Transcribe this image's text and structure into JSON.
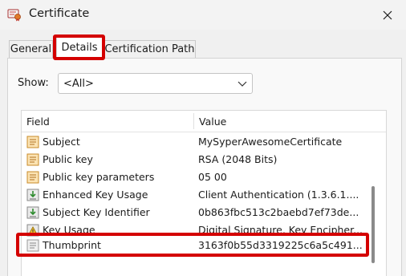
{
  "window": {
    "title": "Certificate"
  },
  "tabs": [
    {
      "label": "General"
    },
    {
      "label": "Details"
    },
    {
      "label": "Certification Path"
    }
  ],
  "show": {
    "label": "Show:",
    "selected": "<All>"
  },
  "table": {
    "headers": {
      "field": "Field",
      "value": "Value"
    },
    "rows": [
      {
        "field": "Subject",
        "value": "MySyperAwesomeCertificate",
        "icon": "cert-field-icon"
      },
      {
        "field": "Public key",
        "value": "RSA (2048 Bits)",
        "icon": "cert-field-icon"
      },
      {
        "field": "Public key parameters",
        "value": "05 00",
        "icon": "cert-field-icon"
      },
      {
        "field": "Enhanced Key Usage",
        "value": "Client Authentication (1.3.6.1....",
        "icon": "extension-icon"
      },
      {
        "field": "Subject Key Identifier",
        "value": "0b863fbc513c2baebd7ef73de...",
        "icon": "extension-icon"
      },
      {
        "field": "Key Usage",
        "value": "Digital Signature, Key Encipher...",
        "icon": "warning-extension-icon"
      },
      {
        "field": "Thumbprint",
        "value": "3163f0b55d3319225c6a5c491...",
        "icon": "property-icon"
      }
    ]
  },
  "colors": {
    "highlight": "#d40000",
    "selection": "#ffffff"
  }
}
